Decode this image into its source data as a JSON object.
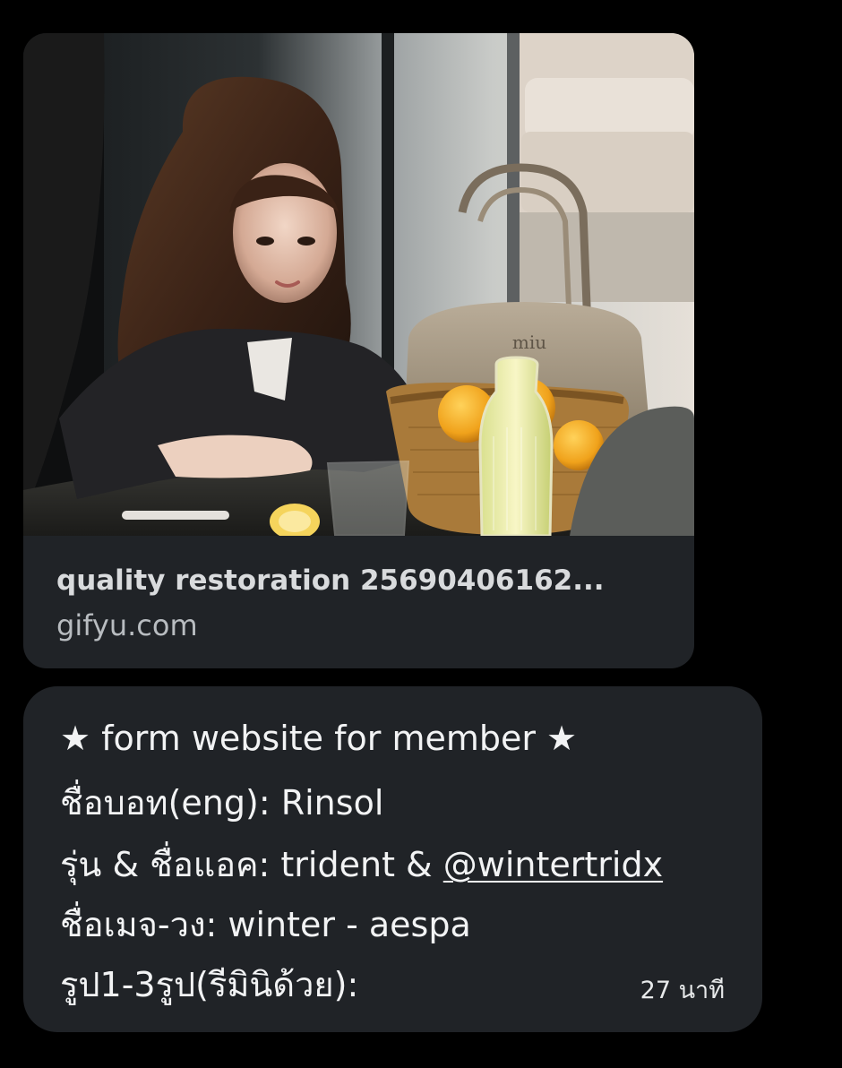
{
  "link_card": {
    "title": "quality restoration 25690406162...",
    "domain": "gifyu.com"
  },
  "message": {
    "line1": "★ form website for member ★",
    "line2": "ชื่อบอท(eng): Rinsol",
    "line3_prefix": "รุ่น & ชื่อแอค: trident & ",
    "line3_mention": "@wintertridx",
    "line4": "ชื่อเมจ-วง: winter - aespa",
    "line5": "รูป1-3รูป(รีมินิด้วย):",
    "timestamp": "27 นาที"
  },
  "image_mark": {
    "bag_logo": "miu"
  },
  "colors": {
    "background": "#000000",
    "bubble": "#202327",
    "primary_text": "#f2f3f4",
    "secondary_text": "#b8bcc0"
  }
}
